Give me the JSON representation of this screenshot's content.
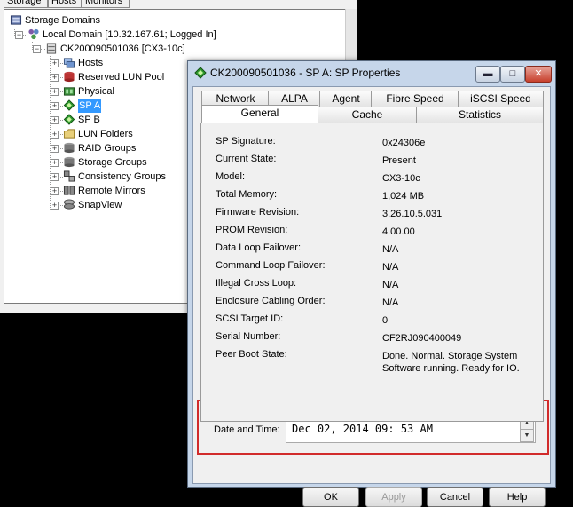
{
  "bg_window": {
    "tabs": [
      "Storage",
      "Hosts",
      "Monitors"
    ],
    "tree": [
      {
        "label": "Storage Domains",
        "icon": "storage-domains-icon",
        "level": 0
      },
      {
        "label": "Local Domain [10.32.167.61; Logged In]",
        "icon": "local-domain-icon",
        "level": 1
      },
      {
        "label": "CK200090501036 [CX3-10c]",
        "icon": "storage-system-icon",
        "level": 2
      },
      {
        "label": "Hosts",
        "icon": "hosts-icon",
        "level": 3
      },
      {
        "label": "Reserved LUN Pool",
        "icon": "lun-pool-icon",
        "level": 3
      },
      {
        "label": "Physical",
        "icon": "physical-icon",
        "level": 3
      },
      {
        "label": "SP A",
        "icon": "sp-icon",
        "level": 3,
        "selected": true
      },
      {
        "label": "SP B",
        "icon": "sp-icon",
        "level": 3
      },
      {
        "label": "LUN Folders",
        "icon": "folder-icon",
        "level": 3
      },
      {
        "label": "RAID Groups",
        "icon": "disk-stack-icon",
        "level": 3
      },
      {
        "label": "Storage Groups",
        "icon": "disk-stack-icon",
        "level": 3
      },
      {
        "label": "Consistency Groups",
        "icon": "consistency-icon",
        "level": 3
      },
      {
        "label": "Remote Mirrors",
        "icon": "mirror-icon",
        "level": 3
      },
      {
        "label": "SnapView",
        "icon": "snapview-icon",
        "level": 3
      }
    ]
  },
  "dialog": {
    "title": "CK200090501036 - SP A: SP Properties",
    "tabs_back": [
      "Network",
      "ALPA",
      "Agent",
      "Fibre Speed",
      "iSCSI Speed"
    ],
    "tabs_front": [
      "General",
      "Cache",
      "Statistics"
    ],
    "active_tab": "General",
    "properties": [
      {
        "label": "SP Signature:",
        "value": "0x24306e"
      },
      {
        "label": "Current State:",
        "value": "Present"
      },
      {
        "label": "Model:",
        "value": "CX3-10c"
      },
      {
        "label": "Total Memory:",
        "value": "1,024 MB"
      },
      {
        "label": "Firmware Revision:",
        "value": "3.26.10.5.031"
      },
      {
        "label": "PROM Revision:",
        "value": "4.00.00"
      },
      {
        "label": "Data Loop Failover:",
        "value": "N/A"
      },
      {
        "label": "Command Loop Failover:",
        "value": "N/A"
      },
      {
        "label": "Illegal Cross Loop:",
        "value": "N/A"
      },
      {
        "label": "Enclosure Cabling Order:",
        "value": "N/A"
      },
      {
        "label": "SCSI Target ID:",
        "value": "0"
      },
      {
        "label": "Serial Number:",
        "value": "CF2RJ090400049"
      },
      {
        "label": "Peer Boot State:",
        "value": "Done. Normal. Storage System Software running. Ready for IO."
      }
    ],
    "datetime_label": "Date and Time:",
    "datetime_value": "Dec 02, 2014 09: 53 AM",
    "buttons": {
      "ok": "OK",
      "apply": "Apply",
      "cancel": "Cancel",
      "help": "Help"
    },
    "apply_enabled": false
  },
  "colors": {
    "selection": "#3399ff",
    "highlight_box": "#d12b2b"
  }
}
